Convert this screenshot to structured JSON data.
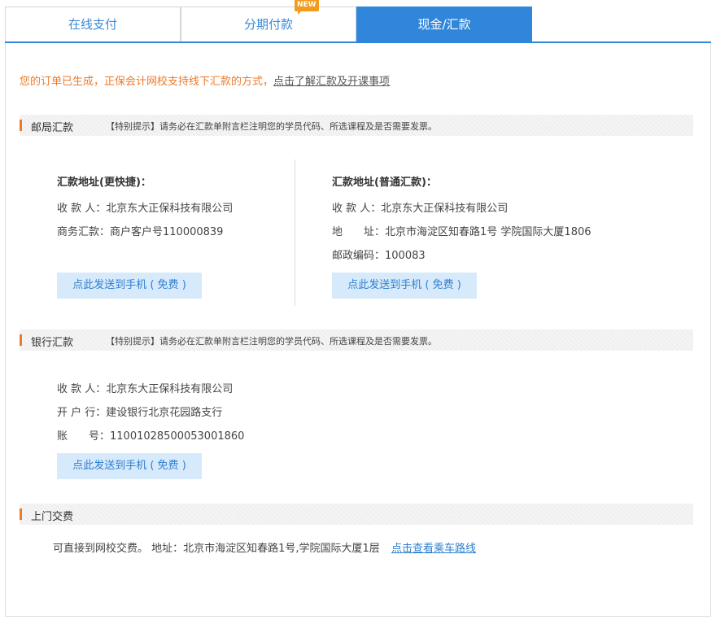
{
  "tabs": [
    {
      "label": "在线支付"
    },
    {
      "label": "分期付款",
      "badge": "NEW"
    },
    {
      "label": "现金/汇款"
    }
  ],
  "notice": {
    "text": "您的订单已生成，正保会计网校支持线下汇款的方式，",
    "link": "点击了解汇款及开课事项"
  },
  "post": {
    "title": "邮局汇款",
    "tip": "【特别提示】请务必在汇款单附言栏注明您的学员代码、所选课程及是否需要发票。",
    "left": {
      "heading": "汇款地址(更快捷)：",
      "payee": "收 款 人：北京东大正保科技有限公司",
      "business": "商务汇款：商户客户号110000839",
      "button": "点此发送到手机 ( 免费 )"
    },
    "right": {
      "heading": "汇款地址(普通汇款)：",
      "payee": "收 款 人：北京东大正保科技有限公司",
      "address_label": "地　　址：",
      "address": "北京市海淀区知春路1号 学院国际大厦1806",
      "postcode": "邮政编码：100083",
      "button": "点此发送到手机 ( 免费 )"
    }
  },
  "bank": {
    "title": "银行汇款",
    "tip": "【特别提示】请务必在汇款单附言栏注明您的学员代码、所选课程及是否需要发票。",
    "payee": "收 款 人：北京东大正保科技有限公司",
    "bank_name": "开 户 行：建设银行北京花园路支行",
    "account_label": "账　　号：",
    "account": "11001028500053001860",
    "button": "点此发送到手机 ( 免费 )"
  },
  "visit": {
    "title": "上门交费",
    "text": "可直接到网校交费。 地址：北京市海淀区知春路1号,学院国际大厦1层",
    "link": "点击查看乘车路线"
  },
  "colors": {
    "accent": "#2f86db",
    "orange": "#ec7a2a",
    "button_bg": "#d7eafb"
  }
}
